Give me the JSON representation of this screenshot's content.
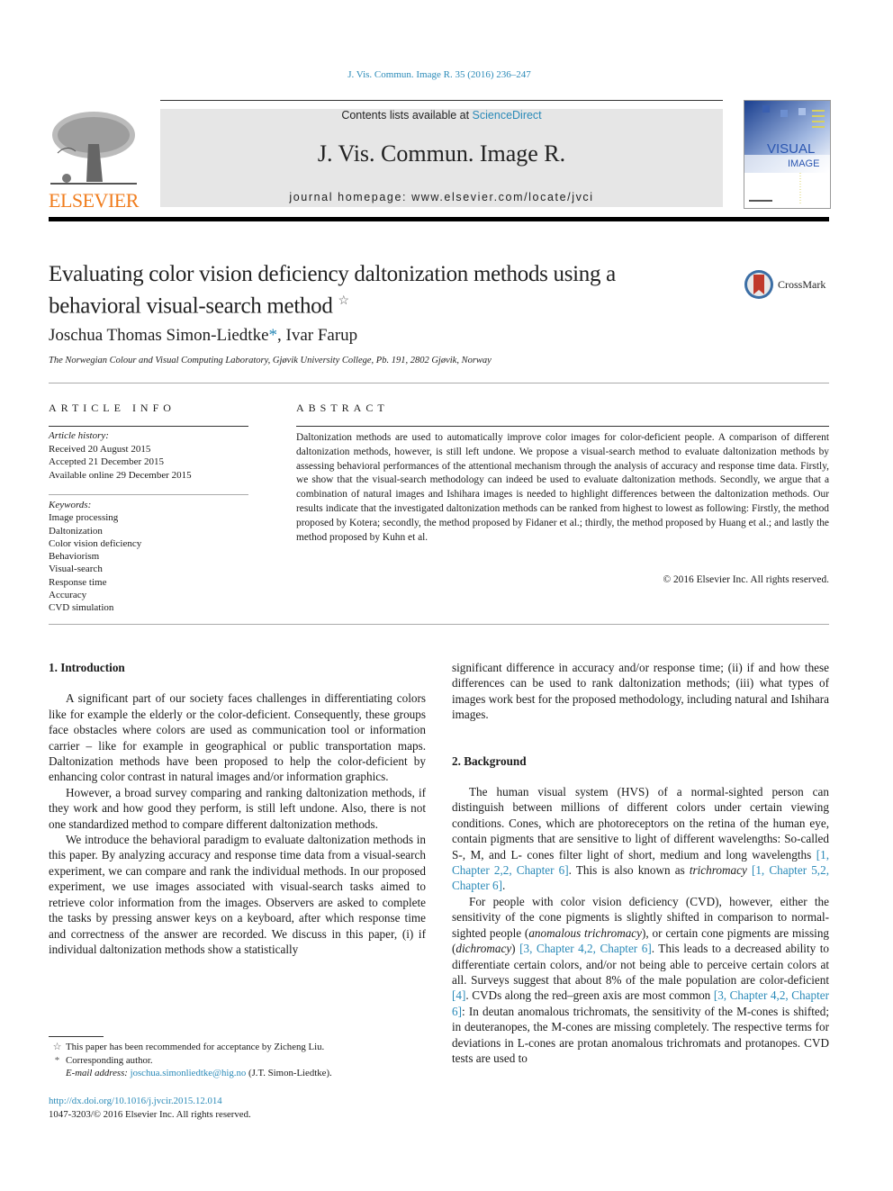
{
  "header": {
    "citation": "J. Vis. Commun. Image R. 35 (2016) 236–247",
    "contents_prefix": "Contents lists available at ",
    "contents_link": "ScienceDirect",
    "journal_name": "J. Vis. Commun. Image R.",
    "homepage": "journal homepage: www.elsevier.com/locate/jvci",
    "publisher": "ELSEVIER",
    "cover_title_1": "VISUAL",
    "cover_title_2": "IMAGE",
    "crossmark": "CrossMark",
    "colors": {
      "link": "#2a8ab8",
      "elsevier_orange": "#f07d1e",
      "masthead_bg": "#e6e6e6"
    }
  },
  "article": {
    "title": "Evaluating color vision deficiency daltonization methods using a behavioral visual-search method",
    "title_mark": "☆",
    "author_1": "Joschua Thomas Simon-Liedtke",
    "author_1_mark": "*",
    "author_sep": ", ",
    "author_2": "Ivar Farup",
    "affiliation": "The Norwegian Colour and Visual Computing Laboratory, Gjøvik University College, Pb. 191, 2802 Gjøvik, Norway"
  },
  "article_info": {
    "heading": "ARTICLE INFO",
    "history_label": "Article history:",
    "history": [
      "Received 20 August 2015",
      "Accepted 21 December 2015",
      "Available online 29 December 2015"
    ],
    "keywords_label": "Keywords:",
    "keywords": [
      "Image processing",
      "Daltonization",
      "Color vision deficiency",
      "Behaviorism",
      "Visual-search",
      "Response time",
      "Accuracy",
      "CVD simulation"
    ]
  },
  "abstract": {
    "heading": "ABSTRACT",
    "text": "Daltonization methods are used to automatically improve color images for color-deficient people. A comparison of different daltonization methods, however, is still left undone. We propose a visual-search method to evaluate daltonization methods by assessing behavioral performances of the attentional mechanism through the analysis of accuracy and response time data. Firstly, we show that the visual-search methodology can indeed be used to evaluate daltonization methods. Secondly, we argue that a combination of natural images and Ishihara images is needed to highlight differences between the daltonization methods. Our results indicate that the investigated daltonization methods can be ranked from highest to lowest as following: Firstly, the method proposed by Kotera; secondly, the method proposed by Fidaner et al.; thirdly, the method proposed by Huang et al.; and lastly the method proposed by Kuhn et al.",
    "copyright": "© 2016 Elsevier Inc. All rights reserved."
  },
  "body": {
    "sec1_heading": "1. Introduction",
    "sec1_p1": "A significant part of our society faces challenges in differentiating colors like for example the elderly or the color-deficient. Consequently, these groups face obstacles where colors are used as communication tool or information carrier – like for example in geographical or public transportation maps. Daltonization methods have been proposed to help the color-deficient by enhancing color contrast in natural images and/or information graphics.",
    "sec1_p2": "However, a broad survey comparing and ranking daltonization methods, if they work and how good they perform, is still left undone. Also, there is not one standardized method to compare different daltonization methods.",
    "sec1_p3": "We introduce the behavioral paradigm to evaluate daltonization methods in this paper. By analyzing accuracy and response time data from a visual-search experiment, we can compare and rank the individual methods. In our proposed experiment, we use images associated with visual-search tasks aimed to retrieve color information from the images. Observers are asked to complete the tasks by pressing answer keys on a keyboard, after which response time and correctness of the answer are recorded. We discuss in this paper, (i) if individual daltonization methods show a statistically",
    "sec1_p3_cont": "significant difference in accuracy and/or response time; (ii) if and how these differences can be used to rank daltonization methods; (iii) what types of images work best for the proposed methodology, including natural and Ishihara images.",
    "sec2_heading": "2. Background",
    "sec2_p1": {
      "t1": "The human visual system (HVS) of a normal-sighted person can distinguish between millions of different colors under certain viewing conditions. Cones, which are photoreceptors on the retina of the human eye, contain pigments that are sensitive to light of different wavelengths: So-called S-, M, and L- cones filter light of short, medium and long wavelengths ",
      "r1": "[1, Chapter 2,2, Chapter 6]",
      "t2": ". This is also known as ",
      "i1": "trichromacy",
      "t3": " ",
      "r2": "[1, Chapter 5,2, Chapter 6]",
      "t4": "."
    },
    "sec2_p2": {
      "t1": "For people with color vision deficiency (CVD), however, either the sensitivity of the cone pigments is slightly shifted in comparison to normal-sighted people (",
      "i1": "anomalous trichromacy",
      "t2": "), or certain cone pigments are missing (",
      "i2": "dichromacy",
      "t3": ") ",
      "r1": "[3, Chapter 4,2, Chapter 6]",
      "t4": ". This leads to a decreased ability to differentiate certain colors, and/or not being able to perceive certain colors at all. Surveys suggest that about 8% of the male population are color-deficient ",
      "r2": "[4]",
      "t5": ". CVDs along the red–green axis are most common ",
      "r3": "[3, Chapter 4,2, Chapter 6]",
      "t6": ": In deutan anomalous trichromats, the sensitivity of the M-cones is shifted; in deuteranopes, the M-cones are missing completely. The respective terms for deviations in L-cones are protan anomalous trichromats and protanopes. CVD tests are used to"
    }
  },
  "footnotes": {
    "star_mark": "☆",
    "star_text": "This paper has been recommended for acceptance by Zicheng Liu.",
    "ast_mark": "*",
    "ast_text": "Corresponding author.",
    "email_label": "E-mail address: ",
    "email": "joschua.simonliedtke@hig.no",
    "email_suffix": " (J.T. Simon-Liedtke).",
    "doi": "http://dx.doi.org/10.1016/j.jvcir.2015.12.014",
    "issn": "1047-3203/© 2016 Elsevier Inc. All rights reserved."
  }
}
